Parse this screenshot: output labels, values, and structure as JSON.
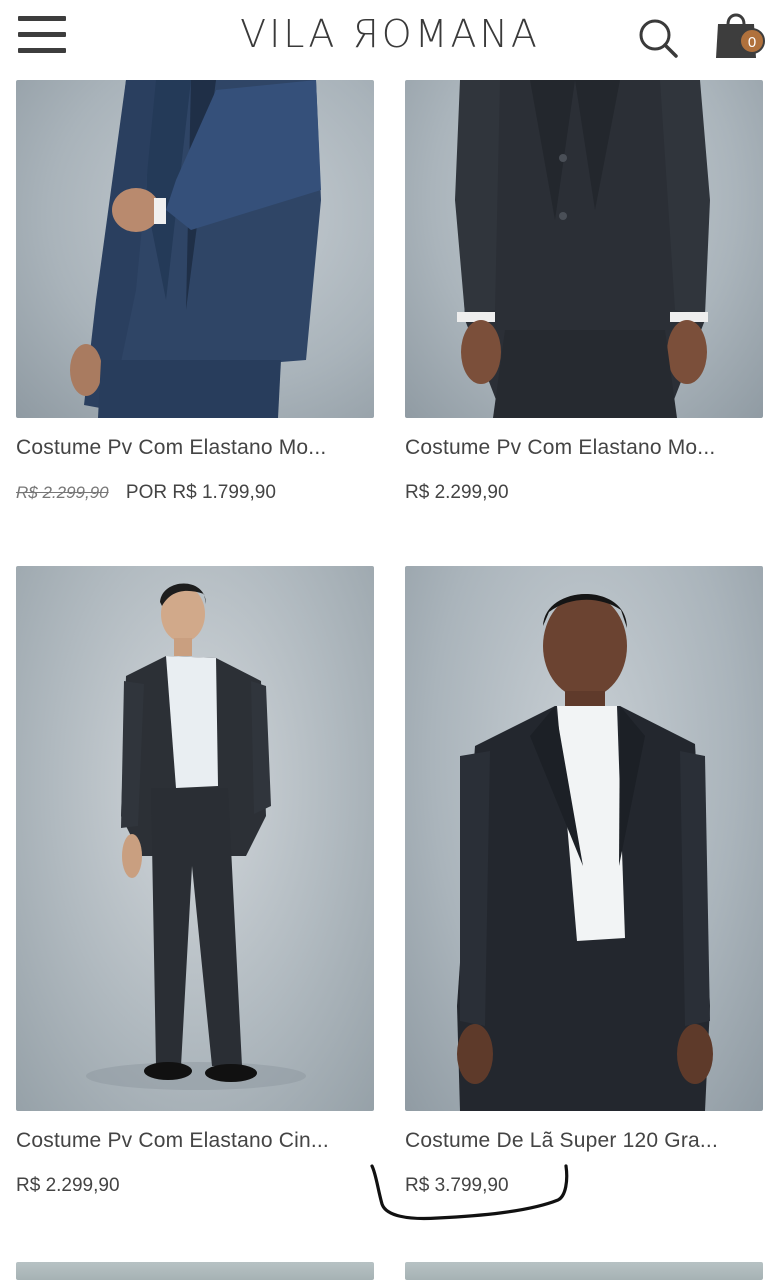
{
  "header": {
    "logo": "VILA ЯOMANA",
    "cart_count": "0"
  },
  "products": [
    {
      "name": "Costume Pv Com Elastano Mo...",
      "old_price": "R$ 2.299,90",
      "price": "POR R$ 1.799,90"
    },
    {
      "name": "Costume Pv Com Elastano Mo...",
      "old_price": "",
      "price": "R$ 2.299,90"
    },
    {
      "name": "Costume Pv Com Elastano Cin...",
      "old_price": "",
      "price": "R$ 2.299,90"
    },
    {
      "name": "Costume De Lã Super 120 Gra...",
      "old_price": "",
      "price": "R$ 3.799,90"
    }
  ],
  "colors": {
    "navy_suit": "#2f4566",
    "charcoal_suit": "#2b2f36",
    "cart_badge": "#b0713c"
  }
}
